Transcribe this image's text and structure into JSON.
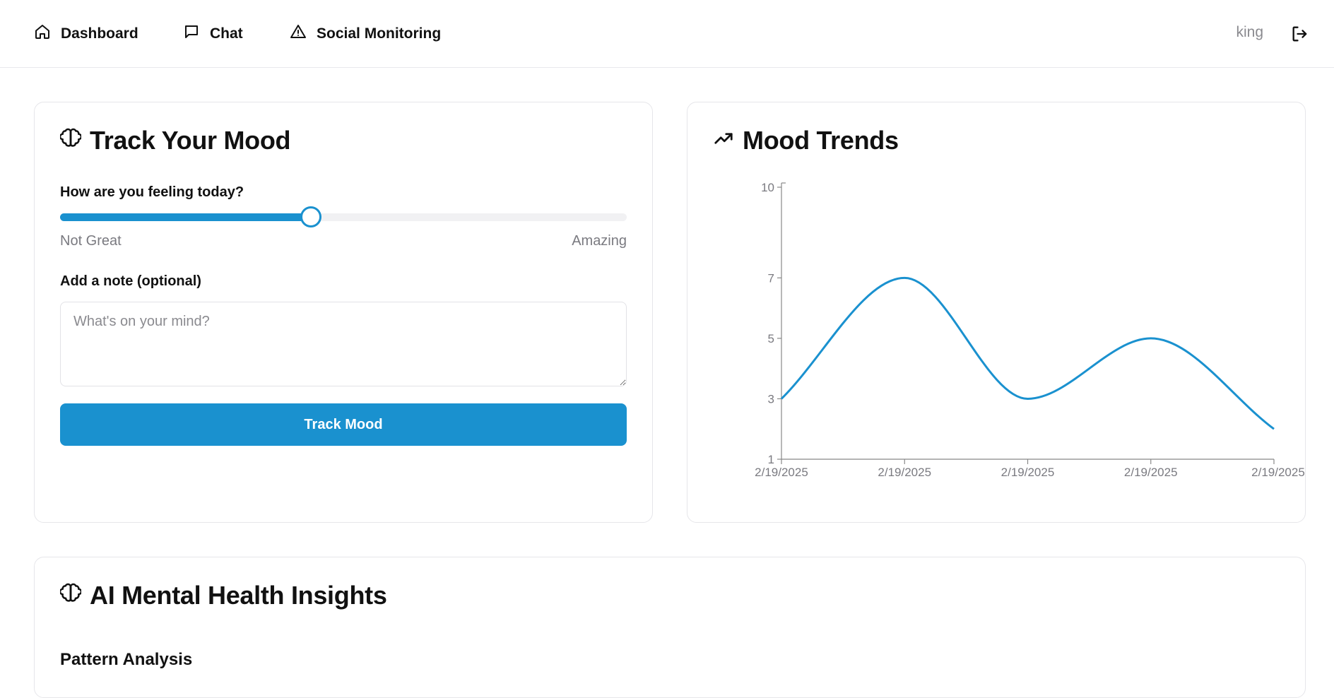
{
  "nav": {
    "items": [
      {
        "label": "Dashboard",
        "icon": "home-icon"
      },
      {
        "label": "Chat",
        "icon": "message-icon"
      },
      {
        "label": "Social Monitoring",
        "icon": "alert-triangle-icon"
      }
    ],
    "username": "king",
    "logout_icon": "logout-icon"
  },
  "mood_card": {
    "title": "Track Your Mood",
    "icon": "brain-icon",
    "question": "How are you feeling today?",
    "slider_value": 5,
    "slider_min": 1,
    "slider_max": 10,
    "low_label": "Not Great",
    "high_label": "Amazing",
    "note_label": "Add a note (optional)",
    "note_placeholder": "What's on your mind?",
    "note_value": "",
    "submit_label": "Track Mood"
  },
  "trends_card": {
    "title": "Mood Trends",
    "icon": "trending-up-icon"
  },
  "insights_card": {
    "title": "AI Mental Health Insights",
    "icon": "brain-icon",
    "section_heading": "Pattern Analysis"
  },
  "colors": {
    "accent": "#1a91cf",
    "border": "#e6e6ea",
    "muted_text": "#7a7a80"
  },
  "chart_data": {
    "type": "line",
    "x": [
      "2/19/2025",
      "2/19/2025",
      "2/19/2025",
      "2/19/2025",
      "2/19/2025"
    ],
    "series": [
      {
        "values": [
          3,
          7,
          3,
          5,
          2
        ]
      }
    ],
    "y_ticks": [
      1,
      3,
      5,
      7,
      10
    ],
    "ylim": [
      1,
      10
    ],
    "grid": false,
    "curve": "smooth"
  }
}
